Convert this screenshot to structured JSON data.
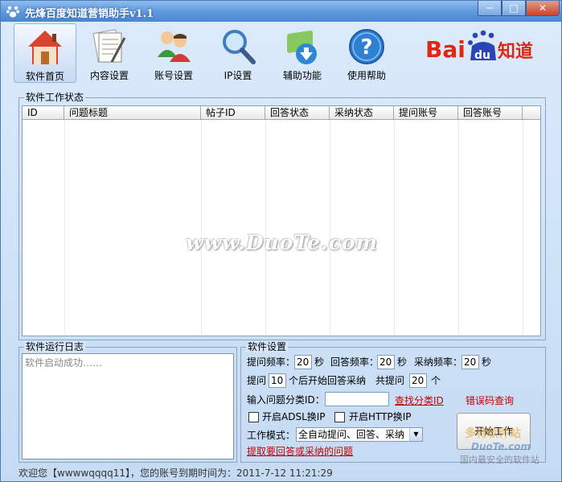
{
  "window": {
    "title": "先烽百度知道营销助手v1.1",
    "controls": {
      "minimize": "─",
      "maximize": "□",
      "close": "✕"
    }
  },
  "toolbar": {
    "items": [
      {
        "label": "软件首页",
        "icon": "home-icon",
        "active": true
      },
      {
        "label": "内容设置",
        "icon": "document-pen-icon"
      },
      {
        "label": "账号设置",
        "icon": "users-icon"
      },
      {
        "label": "IP设置",
        "icon": "magnifier-icon"
      },
      {
        "label": "辅助功能",
        "icon": "download-tool-icon"
      },
      {
        "label": "使用帮助",
        "icon": "help-icon"
      }
    ]
  },
  "brand": {
    "logo_text_left": "Bai",
    "logo_text_du": "du",
    "logo_text_right": "知道"
  },
  "work_status": {
    "title": "软件工作状态",
    "columns": [
      "ID",
      "问题标题",
      "帖子ID",
      "回答状态",
      "采纳状态",
      "提问账号",
      "回答账号"
    ],
    "rows": [],
    "watermark": "www.DuoTe.com"
  },
  "log": {
    "title": "软件运行日志",
    "lines": [
      "软件启动成功……"
    ]
  },
  "settings": {
    "title": "软件设置",
    "ask_freq_label": "提问频率：",
    "ask_freq_value": "20",
    "answer_freq_label": "回答频率：",
    "answer_freq_value": "20",
    "adopt_freq_label": "采纳频率：",
    "adopt_freq_value": "20",
    "seconds_unit": "秒",
    "ask_prefix": "提问",
    "ask_count_value": "10",
    "ask_middle": "个后开始回答采纳",
    "total_ask_label": "共提问",
    "total_ask_value": "20",
    "count_unit": "个",
    "category_label": "输入问题分类ID：",
    "category_value": "",
    "find_category_link": "查找分类ID",
    "error_code_link": "错误码查询",
    "adsl_label": "开启ADSL换IP",
    "adsl_checked": false,
    "http_label": "开启HTTP换IP",
    "http_checked": false,
    "mode_label": "工作模式：",
    "mode_value": "全自动提问、回答、采纳",
    "fetch_link": "提取要回答或采纳的问题",
    "start_button": "开始工作"
  },
  "status_bar": {
    "text": "欢迎您【wwwwqqqq11】，您的账号到期时间为：2011-7-12 11:21:29"
  },
  "corner_watermark": {
    "line1": "多特软件站",
    "line2": "DuoTe.com",
    "line3": "国内最安全的软件站"
  }
}
